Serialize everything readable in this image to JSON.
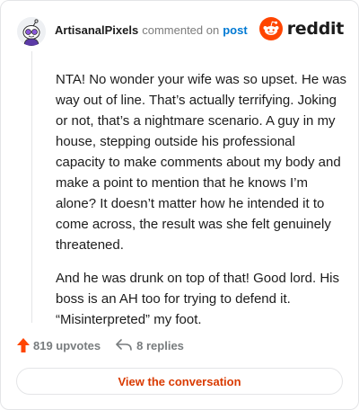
{
  "header": {
    "username": "ArtisanalPixels",
    "action_text": "commented on",
    "post_link": "post"
  },
  "brand": {
    "wordmark": "reddit",
    "logo_icon": "reddit-snoo-icon",
    "color": "#ff4500"
  },
  "comment": {
    "paragraphs": [
      "NTA! No wonder your wife was so upset. He was way out of line. That’s actually terrifying. Joking or not, that’s a nightmare scenario. A guy in my house, stepping outside his professional capacity to make comments about my body and make a point to mention that he knows I’m alone? It doesn’t matter how he intended it to come across, the result was she felt genuinely threatened.",
      "And he was drunk on top of that! Good lord. His boss is an AH too for trying to defend it. “Misinterpreted” my foot."
    ]
  },
  "actions": {
    "upvotes_label": "819 upvotes",
    "upvote_icon": "upvote-arrow-icon",
    "upvote_color": "#ff4500",
    "replies_label": "8 replies",
    "reply_icon": "reply-arrow-icon"
  },
  "cta": {
    "label": "View the conversation",
    "color": "#d93a00"
  },
  "colors": {
    "link": "#0079d3",
    "muted": "#787c7e",
    "text": "#1c1c1c",
    "border": "#e4e5e7"
  }
}
